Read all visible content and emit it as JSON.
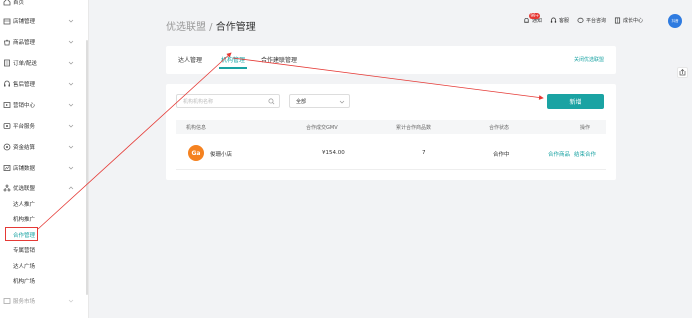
{
  "sidebar": {
    "top_item": "首页",
    "items": [
      {
        "label": "店铺管理",
        "icon": "store-icon"
      },
      {
        "label": "商品管理",
        "icon": "bag-icon"
      },
      {
        "label": "订单/配送",
        "icon": "order-icon"
      },
      {
        "label": "售后管理",
        "icon": "headset-icon"
      },
      {
        "label": "营销中心",
        "icon": "marketing-icon"
      },
      {
        "label": "平台服务",
        "icon": "service-icon"
      },
      {
        "label": "资金结算",
        "icon": "money-icon"
      },
      {
        "label": "店铺数据",
        "icon": "data-icon"
      },
      {
        "label": "优选联盟",
        "icon": "alliance-icon"
      }
    ],
    "sub_items": [
      "达人推广",
      "机构推广",
      "合作管理",
      "专属营销",
      "达人广场",
      "机构广场"
    ],
    "active_sub": "合作管理",
    "bottom_item": "服务市场"
  },
  "header": {
    "breadcrumb_parent": "优选联盟",
    "breadcrumb_sep": " / ",
    "breadcrumb_current": "合作管理",
    "notif_badge": "99+",
    "notif_label": "通知",
    "support_label": "客服",
    "suggest_label": "平台咨询",
    "growth_label": "成长中心",
    "avatar_text": "抖音"
  },
  "tabs": {
    "items": [
      "达人管理",
      "机构管理",
      "合作建联管理"
    ],
    "active": "机构管理",
    "right_link": "关闭优选联盟"
  },
  "filters": {
    "search_placeholder": "机构机构名称",
    "select_value": "全部",
    "new_button": "新增"
  },
  "table": {
    "columns": [
      "机构信息",
      "合作成交GMV",
      "累计合作商品数",
      "合作状态",
      "操作"
    ],
    "rows": [
      {
        "logo_text": "Ga",
        "name": "俊珊小店",
        "gmv": "¥154.00",
        "count": "7",
        "status": "合作中",
        "action1": "合作商品",
        "action2": "结束合作"
      }
    ]
  },
  "colors": {
    "accent": "#1aa3a3",
    "annotation": "#e53935",
    "logo": "#f58220"
  }
}
